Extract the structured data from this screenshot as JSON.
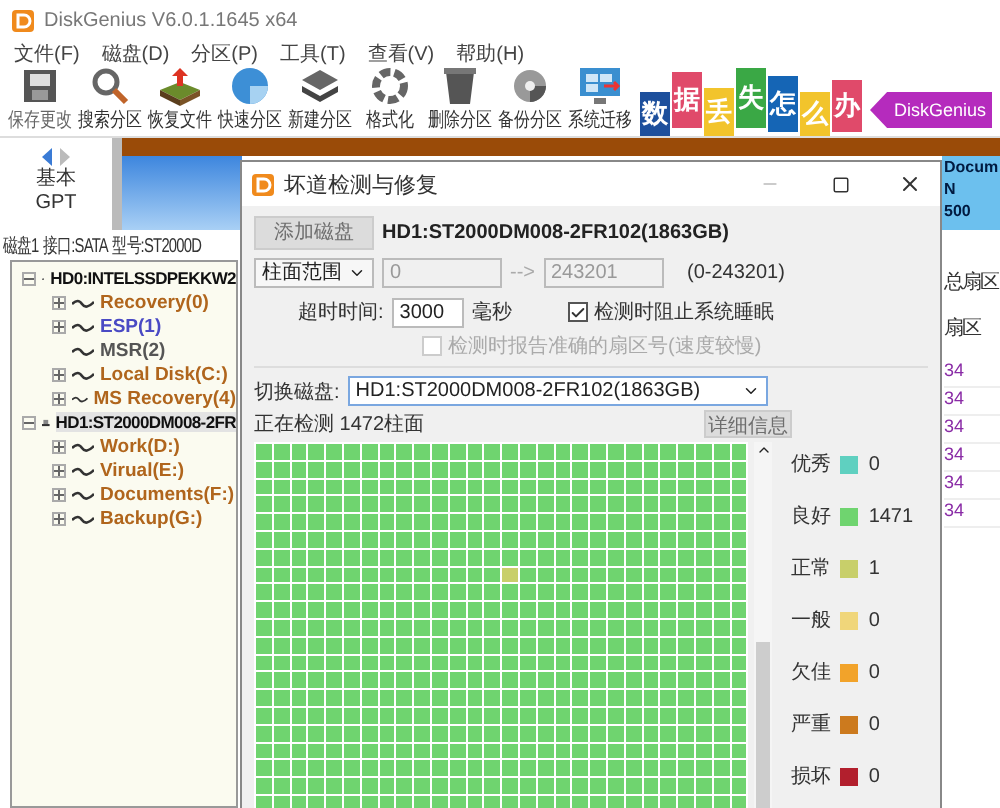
{
  "window": {
    "title": "DiskGenius V6.0.1.1645 x64"
  },
  "menu": [
    "文件(F)",
    "磁盘(D)",
    "分区(P)",
    "工具(T)",
    "查看(V)",
    "帮助(H)"
  ],
  "toolbar": [
    {
      "kind": "save",
      "label": "保存更改",
      "disabled": true
    },
    {
      "kind": "search",
      "label": "搜索分区",
      "disabled": false
    },
    {
      "kind": "restore",
      "label": "恢复文件",
      "disabled": false
    },
    {
      "kind": "quick",
      "label": "快速分区",
      "disabled": false
    },
    {
      "kind": "new",
      "label": "新建分区",
      "disabled": false
    },
    {
      "kind": "format",
      "label": "格式化",
      "disabled": false
    },
    {
      "kind": "delete",
      "label": "删除分区",
      "disabled": false
    },
    {
      "kind": "backup",
      "label": "备份分区",
      "disabled": false
    },
    {
      "kind": "migrate",
      "label": "系统迁移",
      "disabled": false
    }
  ],
  "banner": {
    "tiles": [
      {
        "text": "数",
        "color": "#1d4f9c"
      },
      {
        "text": "据",
        "color": "#e04a6a"
      },
      {
        "text": "丢",
        "color": "#f2c42c"
      },
      {
        "text": "失",
        "color": "#3aa845"
      },
      {
        "text": "怎",
        "color": "#1565b5"
      },
      {
        "text": "么",
        "color": "#f2c42c"
      },
      {
        "text": "办",
        "color": "#e04a6a"
      }
    ],
    "arrow_text": "DiskGenius"
  },
  "disk_bar": {
    "type_lines": [
      "基本",
      "GPT"
    ],
    "partition_lines": [
      "Docum",
      "N",
      "500"
    ]
  },
  "disk_info": [
    "磁盘1",
    "接口:SATA",
    "型号:ST2000D"
  ],
  "tree": [
    {
      "label": "HD0:INTELSSDPEKKW2",
      "selected": false,
      "expanded": true,
      "children": [
        {
          "label": "Recovery(0)",
          "color": "#b0651c",
          "expanded": false
        },
        {
          "label": "ESP(1)",
          "color": "#4a4ac4",
          "expanded": false
        },
        {
          "label": "MSR(2)",
          "color": "#555555"
        },
        {
          "label": "Local Disk(C:)",
          "color": "#b0651c",
          "expanded": false
        },
        {
          "label": "MS Recovery(4)",
          "color": "#b0651c",
          "expanded": false
        }
      ]
    },
    {
      "label": "HD1:ST2000DM008-2FR",
      "selected": true,
      "expanded": true,
      "children": [
        {
          "label": "Work(D:)",
          "color": "#b0651c",
          "expanded": false
        },
        {
          "label": "Virual(E:)",
          "color": "#b0651c",
          "expanded": false
        },
        {
          "label": "Documents(F:)",
          "color": "#b0651c",
          "expanded": false
        },
        {
          "label": "Backup(G:)",
          "color": "#b0651c",
          "expanded": false
        }
      ]
    }
  ],
  "side_table": {
    "headers": [
      "总扇区",
      "扇区"
    ],
    "cells": [
      "34",
      "34",
      "34",
      "34",
      "34",
      "34"
    ]
  },
  "dialog": {
    "title": "坏道检测与修复",
    "add_disk_button": {
      "label": "添加磁盘",
      "disabled": true
    },
    "disk_name": "HD1:ST2000DM008-2FR102(1863GB)",
    "range_select": "柱面范围",
    "range_start": "0",
    "range_arrow": "-->",
    "range_end": "243201",
    "range_hint": "(0-243201)",
    "timeout_label": "超时时间:",
    "timeout_value": "3000",
    "timeout_unit": "毫秒",
    "checkboxes": [
      {
        "label": "检测时阻止系统睡眠",
        "checked": true,
        "disabled": false
      },
      {
        "label": "检测时报告准确的扇区号(速度较慢)",
        "checked": false,
        "disabled": true
      }
    ],
    "switch_label": "切换磁盘:",
    "switch_value": "HD1:ST2000DM008-2FR102(1863GB)",
    "status": "正在检测 1472柱面",
    "details_button": {
      "label": "详细信息",
      "disabled": true
    },
    "legend": [
      {
        "kind": "excellent",
        "label": "优秀",
        "color": "#5fd0c0",
        "count": "0"
      },
      {
        "kind": "good",
        "label": "良好",
        "color": "#6fd46f",
        "count": "1471"
      },
      {
        "kind": "normal",
        "label": "正常",
        "color": "#c8cf6a",
        "count": "1"
      },
      {
        "kind": "fair",
        "label": "一般",
        "color": "#f0d67a",
        "count": "0"
      },
      {
        "kind": "poor",
        "label": "欠佳",
        "color": "#f2a32a",
        "count": "0"
      },
      {
        "kind": "severe",
        "label": "严重",
        "color": "#cc7a1e",
        "count": "0"
      },
      {
        "kind": "damaged",
        "label": "损坏",
        "color": "#b21f2d",
        "count": "0"
      }
    ],
    "grid_flagged": [
      [
        false,
        false,
        false,
        false,
        false,
        false,
        false,
        false,
        false,
        false,
        false,
        false,
        false,
        false,
        false,
        false,
        false,
        false,
        false,
        false,
        false,
        false,
        false,
        false,
        false,
        false,
        false,
        false
      ],
      [
        false,
        false,
        false,
        false,
        false,
        false,
        false,
        false,
        false,
        false,
        false,
        false,
        false,
        false,
        false,
        false,
        false,
        false,
        false,
        false,
        false,
        false,
        false,
        false,
        false,
        false,
        false,
        false
      ],
      [
        false,
        false,
        false,
        false,
        false,
        false,
        false,
        false,
        false,
        false,
        false,
        false,
        false,
        false,
        false,
        false,
        false,
        false,
        false,
        false,
        false,
        false,
        false,
        false,
        false,
        false,
        false,
        false
      ],
      [
        false,
        false,
        false,
        false,
        false,
        false,
        false,
        false,
        false,
        false,
        false,
        false,
        false,
        false,
        false,
        false,
        false,
        false,
        false,
        false,
        false,
        false,
        false,
        false,
        false,
        false,
        false,
        false
      ],
      [
        false,
        false,
        false,
        false,
        false,
        false,
        false,
        false,
        false,
        false,
        false,
        false,
        false,
        false,
        false,
        false,
        false,
        false,
        false,
        false,
        false,
        false,
        false,
        false,
        false,
        false,
        false,
        false
      ],
      [
        false,
        false,
        false,
        false,
        false,
        false,
        false,
        false,
        false,
        false,
        false,
        false,
        false,
        false,
        false,
        false,
        false,
        false,
        false,
        false,
        false,
        false,
        false,
        false,
        false,
        false,
        false,
        false
      ],
      [
        false,
        false,
        false,
        false,
        false,
        false,
        false,
        false,
        false,
        false,
        false,
        false,
        false,
        false,
        false,
        false,
        false,
        false,
        false,
        false,
        false,
        false,
        false,
        false,
        false,
        false,
        false,
        false
      ],
      [
        false,
        false,
        false,
        false,
        false,
        false,
        false,
        false,
        false,
        false,
        false,
        false,
        false,
        false,
        true,
        false,
        false,
        false,
        false,
        false,
        false,
        false,
        false,
        false,
        false,
        false,
        false,
        false
      ],
      [
        false,
        false,
        false,
        false,
        false,
        false,
        false,
        false,
        false,
        false,
        false,
        false,
        false,
        false,
        false,
        false,
        false,
        false,
        false,
        false,
        false,
        false,
        false,
        false,
        false,
        false,
        false,
        false
      ],
      [
        false,
        false,
        false,
        false,
        false,
        false,
        false,
        false,
        false,
        false,
        false,
        false,
        false,
        false,
        false,
        false,
        false,
        false,
        false,
        false,
        false,
        false,
        false,
        false,
        false,
        false,
        false,
        false
      ],
      [
        false,
        false,
        false,
        false,
        false,
        false,
        false,
        false,
        false,
        false,
        false,
        false,
        false,
        false,
        false,
        false,
        false,
        false,
        false,
        false,
        false,
        false,
        false,
        false,
        false,
        false,
        false,
        false
      ],
      [
        false,
        false,
        false,
        false,
        false,
        false,
        false,
        false,
        false,
        false,
        false,
        false,
        false,
        false,
        false,
        false,
        false,
        false,
        false,
        false,
        false,
        false,
        false,
        false,
        false,
        false,
        false,
        false
      ],
      [
        false,
        false,
        false,
        false,
        false,
        false,
        false,
        false,
        false,
        false,
        false,
        false,
        false,
        false,
        false,
        false,
        false,
        false,
        false,
        false,
        false,
        false,
        false,
        false,
        false,
        false,
        false,
        false
      ],
      [
        false,
        false,
        false,
        false,
        false,
        false,
        false,
        false,
        false,
        false,
        false,
        false,
        false,
        false,
        false,
        false,
        false,
        false,
        false,
        false,
        false,
        false,
        false,
        false,
        false,
        false,
        false,
        false
      ],
      [
        false,
        false,
        false,
        false,
        false,
        false,
        false,
        false,
        false,
        false,
        false,
        false,
        false,
        false,
        false,
        false,
        false,
        false,
        false,
        false,
        false,
        false,
        false,
        false,
        false,
        false,
        false,
        false
      ],
      [
        false,
        false,
        false,
        false,
        false,
        false,
        false,
        false,
        false,
        false,
        false,
        false,
        false,
        false,
        false,
        false,
        false,
        false,
        false,
        false,
        false,
        false,
        false,
        false,
        false,
        false,
        false,
        false
      ],
      [
        false,
        false,
        false,
        false,
        false,
        false,
        false,
        false,
        false,
        false,
        false,
        false,
        false,
        false,
        false,
        false,
        false,
        false,
        false,
        false,
        false,
        false,
        false,
        false,
        false,
        false,
        false,
        false
      ],
      [
        false,
        false,
        false,
        false,
        false,
        false,
        false,
        false,
        false,
        false,
        false,
        false,
        false,
        false,
        false,
        false,
        false,
        false,
        false,
        false,
        false,
        false,
        false,
        false,
        false,
        false,
        false,
        false
      ],
      [
        false,
        false,
        false,
        false,
        false,
        false,
        false,
        false,
        false,
        false,
        false,
        false,
        false,
        false,
        false,
        false,
        false,
        false,
        false,
        false,
        false,
        false,
        false,
        false,
        false,
        false,
        false,
        false
      ],
      [
        false,
        false,
        false,
        false,
        false,
        false,
        false,
        false,
        false,
        false,
        false,
        false,
        false,
        false,
        false,
        false,
        false,
        false,
        false,
        false,
        false,
        false,
        false,
        false,
        false,
        false,
        false,
        false
      ],
      [
        false,
        false,
        false,
        false,
        false,
        false,
        false,
        false,
        false,
        false,
        false,
        false,
        false,
        false,
        false,
        false,
        false,
        false,
        false,
        false,
        false,
        false,
        false,
        false,
        false,
        false,
        false,
        false
      ]
    ]
  }
}
